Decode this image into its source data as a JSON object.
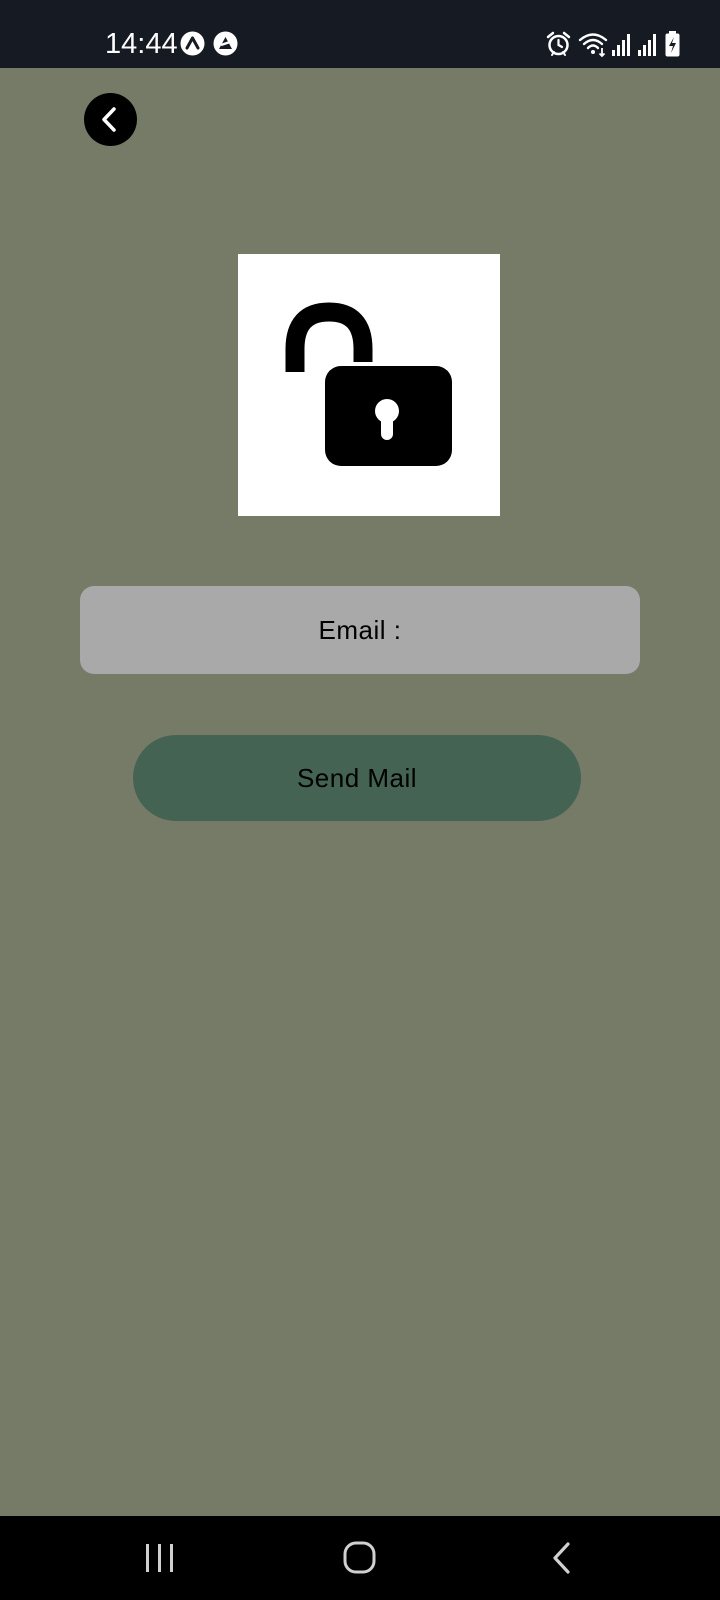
{
  "status_bar": {
    "time": "14:44",
    "left_icons": [
      "notification-a-icon",
      "notification-b-icon"
    ],
    "right_icons": [
      "alarm-icon",
      "wifi-icon",
      "signal-icon",
      "signal-icon",
      "battery-charging-icon"
    ]
  },
  "screen": {
    "back_icon": "chevron-left-icon",
    "hero_icon": "unlocked-padlock-icon",
    "email_label": "Email :",
    "send_button_label": "Send Mail",
    "colors": {
      "background": "#767b67",
      "field": "#a9a9a9",
      "button": "#446353",
      "status_bar": "#151a23"
    }
  },
  "nav_bar": {
    "items": [
      "recent-apps-icon",
      "home-icon",
      "back-icon"
    ]
  }
}
